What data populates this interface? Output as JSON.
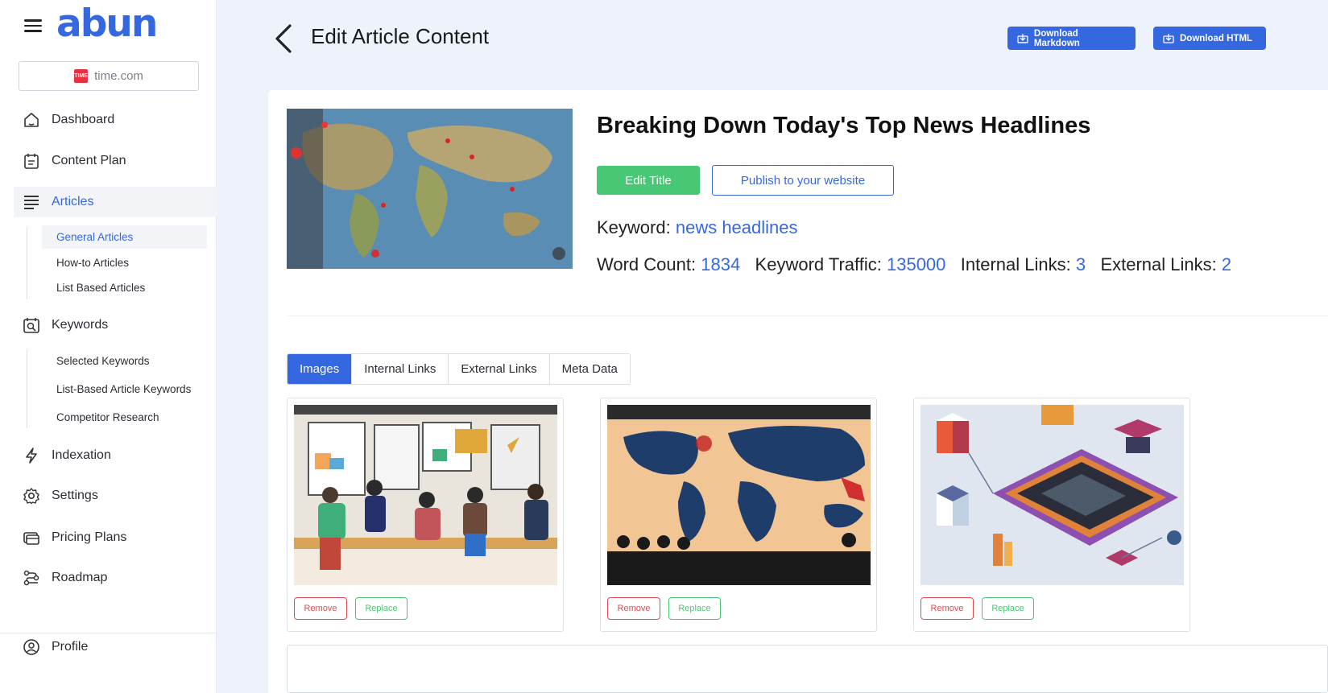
{
  "app": {
    "logo": "abun"
  },
  "site_selector": {
    "value": "time.com",
    "favicon_text": "TIME"
  },
  "sidebar": {
    "items": [
      {
        "label": "Dashboard",
        "icon": "home-icon"
      },
      {
        "label": "Content Plan",
        "icon": "clipboard-icon"
      },
      {
        "label": "Articles",
        "icon": "articles-icon",
        "active": true
      },
      {
        "label": "Keywords",
        "icon": "keyword-search-icon"
      },
      {
        "label": "Indexation",
        "icon": "lightning-icon"
      },
      {
        "label": "Settings",
        "icon": "gear-icon"
      },
      {
        "label": "Pricing Plans",
        "icon": "card-icon"
      },
      {
        "label": "Roadmap",
        "icon": "roadmap-icon"
      }
    ],
    "article_sub": [
      "General Articles",
      "How-to Articles",
      "List Based Articles"
    ],
    "keyword_sub": [
      "Selected Keywords",
      "List-Based Article Keywords",
      "Competitor Research"
    ],
    "profile": {
      "label": "Profile",
      "icon": "profile-icon"
    }
  },
  "header": {
    "title": "Edit Article Content",
    "download_markdown": "Download Markdown",
    "download_html": "Download HTML"
  },
  "article": {
    "title": "Breaking Down Today's Top News Headlines",
    "edit_title_label": "Edit Title",
    "publish_label": "Publish to your website",
    "keyword_label": "Keyword:",
    "keyword": "news headlines",
    "stats": {
      "word_count_label": "Word Count:",
      "word_count": "1834",
      "traffic_label": "Keyword Traffic:",
      "traffic": "135000",
      "internal_label": "Internal Links:",
      "internal": "3",
      "external_label": "External Links:",
      "external": "2"
    }
  },
  "tabs": [
    "Images",
    "Internal Links",
    "External Links",
    "Meta Data"
  ],
  "image_cards": [
    {
      "remove": "Remove",
      "replace": "Replace"
    },
    {
      "remove": "Remove",
      "replace": "Replace"
    },
    {
      "remove": "Remove",
      "replace": "Replace"
    }
  ],
  "colors": {
    "accent": "#3568e0",
    "success": "#48c774",
    "danger": "#e04a55",
    "background": "#eef2fb"
  }
}
